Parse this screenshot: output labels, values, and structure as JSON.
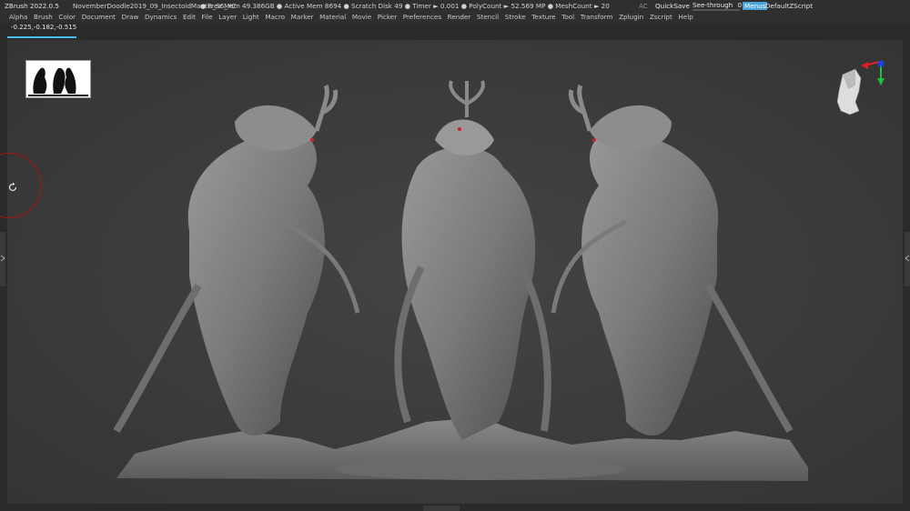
{
  "titlebar": {
    "app_name": "ZBrush 2022.0.5",
    "document": "NovemberDoodle2019_09_InsectoidMantis_S6_XC",
    "stats": "● Free Mem 49.386GB ● Active Mem 8694 ● Scratch Disk 49 ● Timer ► 0.001 ● PolyCount ► 52.569 MP ● MeshCount ► 20",
    "ac_label": "AC",
    "quicksave_label": "QuickSave",
    "see_through_label": "See-through",
    "see_through_value": "0",
    "see_through_level": 0,
    "menus_label": "Menus",
    "zscript_label": "DefaultZScript"
  },
  "menubar": {
    "items": [
      "Alpha",
      "Brush",
      "Color",
      "Document",
      "Draw",
      "Dynamics",
      "Edit",
      "File",
      "Layer",
      "Light",
      "Macro",
      "Marker",
      "Material",
      "Movie",
      "Picker",
      "Preferences",
      "Render",
      "Stencil",
      "Stroke",
      "Texture",
      "Tool",
      "Transform",
      "Zplugin",
      "Zscript",
      "Help"
    ]
  },
  "coords": "-0.225,-0.182,-0.515",
  "icons": {
    "thumbnail": "silhouette-thumbnail",
    "navigator": "head-navigator-icon",
    "rotate": "rotate-icon",
    "tray_left": "chevron-icon",
    "tray_right": "chevron-icon",
    "tray_bottom": "chevron-icon"
  },
  "colors": {
    "accent": "#44c0e8",
    "menus_active": "#4aa3d8",
    "axis_red": "#e02020",
    "axis_green": "#20c040",
    "axis_blue": "#2040e0"
  }
}
